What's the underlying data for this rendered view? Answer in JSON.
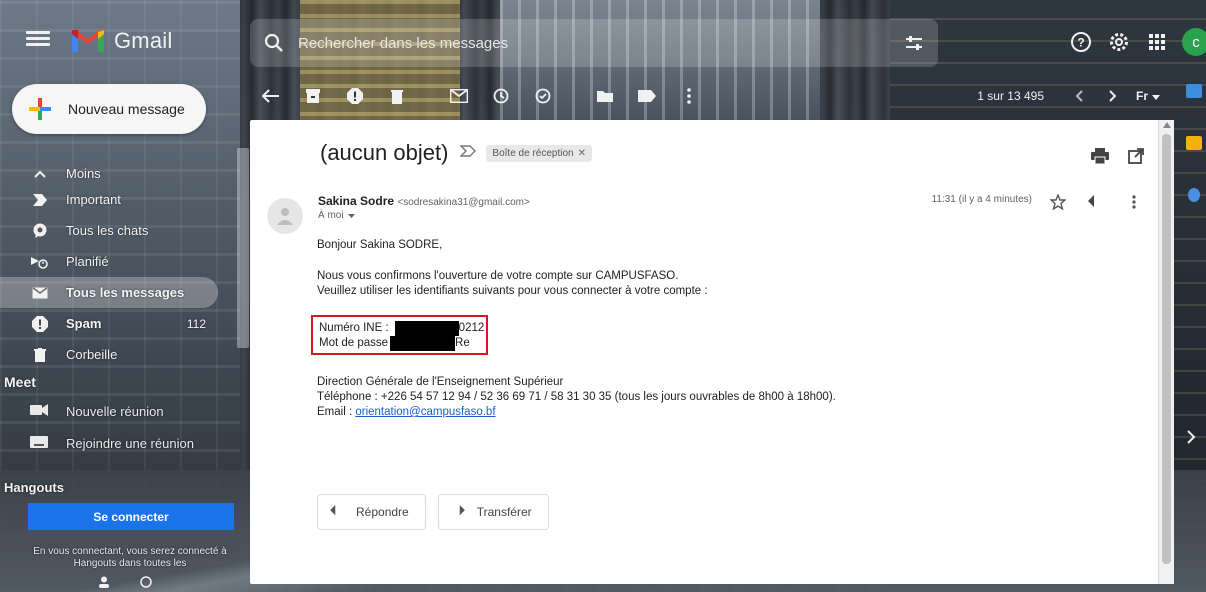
{
  "app": {
    "name": "Gmail",
    "avatar_letter": "c"
  },
  "search": {
    "placeholder": "Rechercher dans les messages"
  },
  "sidebar": {
    "compose_label": "Nouveau message",
    "items": [
      {
        "label": "Moins",
        "icon": "chevron-up-icon"
      },
      {
        "label": "Important",
        "icon": "important-icon"
      },
      {
        "label": "Tous les chats",
        "icon": "chat-icon"
      },
      {
        "label": "Planifié",
        "icon": "scheduled-icon"
      },
      {
        "label": "Tous les messages",
        "icon": "all-mail-icon"
      },
      {
        "label": "Spam",
        "icon": "spam-icon",
        "count": "112"
      },
      {
        "label": "Corbeille",
        "icon": "trash-icon"
      }
    ],
    "meet": {
      "heading": "Meet",
      "new_meeting": "Nouvelle réunion",
      "join_meeting": "Rejoindre une réunion"
    },
    "hangouts": {
      "heading": "Hangouts",
      "connect_button": "Se connecter",
      "note": "En vous connectant, vous serez connecté à Hangouts dans toutes les"
    }
  },
  "toolbar": {
    "pagination": "1 sur 13 495",
    "lang": "Fr"
  },
  "email": {
    "subject": "(aucun objet)",
    "label": "Boîte de réception",
    "sender_name": "Sakina Sodre",
    "sender_email": "<sodresakina31@gmail.com>",
    "to": "À moi",
    "time": "11:31 (il y a 4 minutes)",
    "body": {
      "greeting": "Bonjour Sakina SODRE,",
      "line1": "Nous vous confirmons l'ouverture de votre compte sur CAMPUSFASO.",
      "line2": "Veuillez utiliser les identifiants suivants pour vous connecter à votre compte :",
      "ine_label": "Numéro INE :",
      "ine_suffix": "0212",
      "password_label": "Mot de passe",
      "password_suffix": "Re",
      "signature1": "Direction Générale de l'Enseignement Supérieur",
      "phone": "Téléphone : +226 54 57 12 94 / 52 36 69 71 / 58 31 30 35 (tous les jours ouvrables de 8h00 à 18h00).",
      "email_prefix": "Email : ",
      "email_link": "orientation@campusfaso.bf"
    },
    "reply_label": "Répondre",
    "forward_label": "Transférer"
  },
  "colors": {
    "accent": "#1a73e8",
    "redaction_box": "#d4191c",
    "avatar": "#2aa14c"
  }
}
